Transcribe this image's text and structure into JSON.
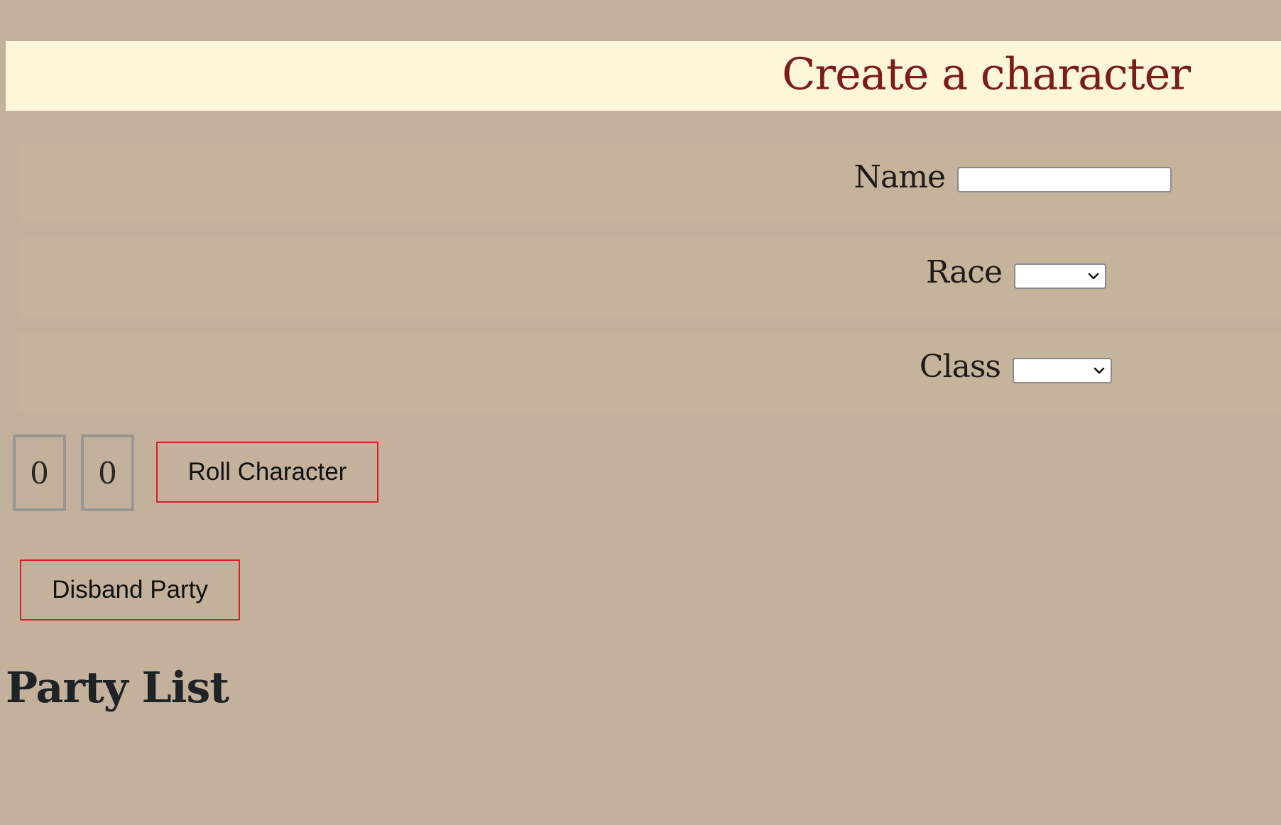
{
  "header": {
    "title": "Create a character"
  },
  "form": {
    "name_label": "Name",
    "name_value": "",
    "race_label": "Race",
    "race_selected": "",
    "class_label": "Class",
    "class_selected": ""
  },
  "stats": {
    "first_value": "0",
    "second_value": "0"
  },
  "buttons": {
    "roll_label": "Roll Character",
    "disband_label": "Disband Party"
  },
  "party": {
    "heading": "Party List",
    "members": []
  },
  "colors": {
    "background": "#c3b19c",
    "header_background": "#fdf6d9",
    "title_color": "#7b1c17",
    "button_border": "#d4222a",
    "stat_border": "#9a9691"
  },
  "icons": {
    "select_arrow": "chevron-down-icon"
  }
}
